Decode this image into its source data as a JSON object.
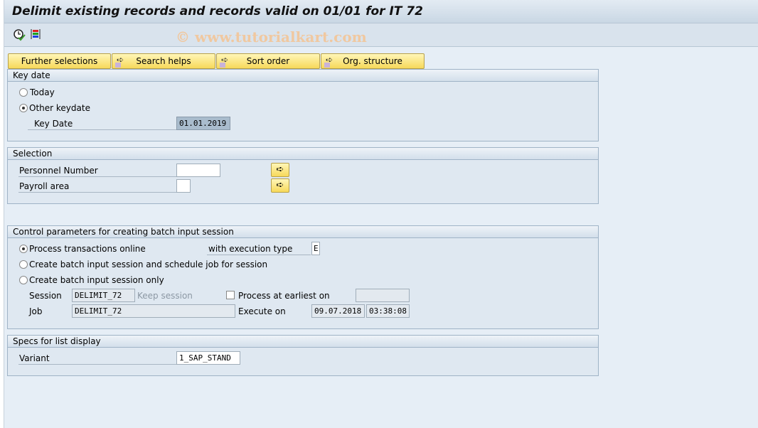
{
  "title": "Delimit existing records and records valid on 01/01 for IT 72",
  "watermark": "© www.tutorialkart.com",
  "toolbar": {
    "icons": [
      "execute-clock-icon",
      "selection-variant-icon"
    ]
  },
  "buttons": {
    "further_selections": "Further selections",
    "search_helps": "Search helps",
    "sort_order": "Sort order",
    "org_structure": "Org. structure"
  },
  "key_date": {
    "header": "Key date",
    "today": "Today",
    "other_keydate": "Other keydate",
    "selected": "Other keydate",
    "key_date_label": "Key Date",
    "key_date_value": "01.01.2019"
  },
  "selection": {
    "header": "Selection",
    "personnel_number": "Personnel Number",
    "personnel_number_value": "",
    "payroll_area": "Payroll area",
    "payroll_area_value": ""
  },
  "control": {
    "header": "Control parameters for creating batch input session",
    "process_online": "Process transactions online",
    "execution_type_label": "with execution type",
    "execution_type_value": "E",
    "create_and_schedule": "Create batch input session and schedule job for session",
    "create_only": "Create batch input session only",
    "selected": "Process transactions online",
    "session_label": "Session",
    "session_value": "DELIMIT_72",
    "keep_session": "Keep session",
    "process_earliest": "Process at earliest on",
    "process_earliest_value": "",
    "job_label": "Job",
    "job_value": "DELIMIT_72",
    "execute_on": "Execute on",
    "execute_date": "09.07.2018",
    "execute_time": "03:38:08"
  },
  "specs": {
    "header": "Specs for list display",
    "variant_label": "Variant",
    "variant_value": "1_SAP_STAND"
  }
}
